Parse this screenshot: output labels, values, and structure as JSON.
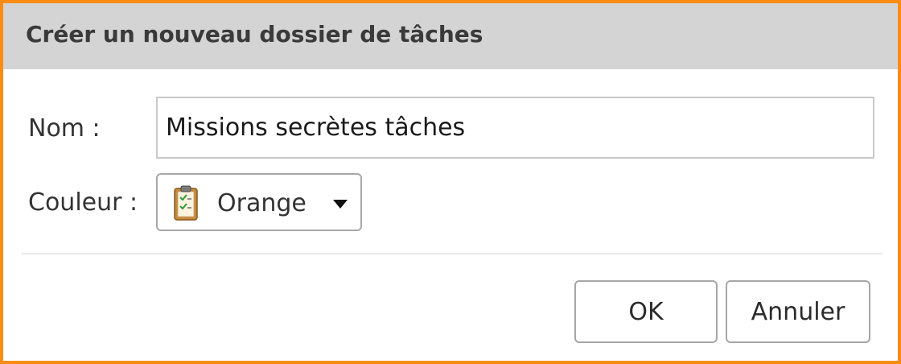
{
  "dialog": {
    "title": "Créer un nouveau dossier de tâches",
    "border_color": "#fa8c14"
  },
  "form": {
    "name_label": "Nom :",
    "name_value": "Missions secrètes tâches",
    "color_label": "Couleur :",
    "color_value": "Orange",
    "color_icon": "clipboard-checklist-icon"
  },
  "buttons": {
    "ok_label": "OK",
    "cancel_label": "Annuler"
  }
}
